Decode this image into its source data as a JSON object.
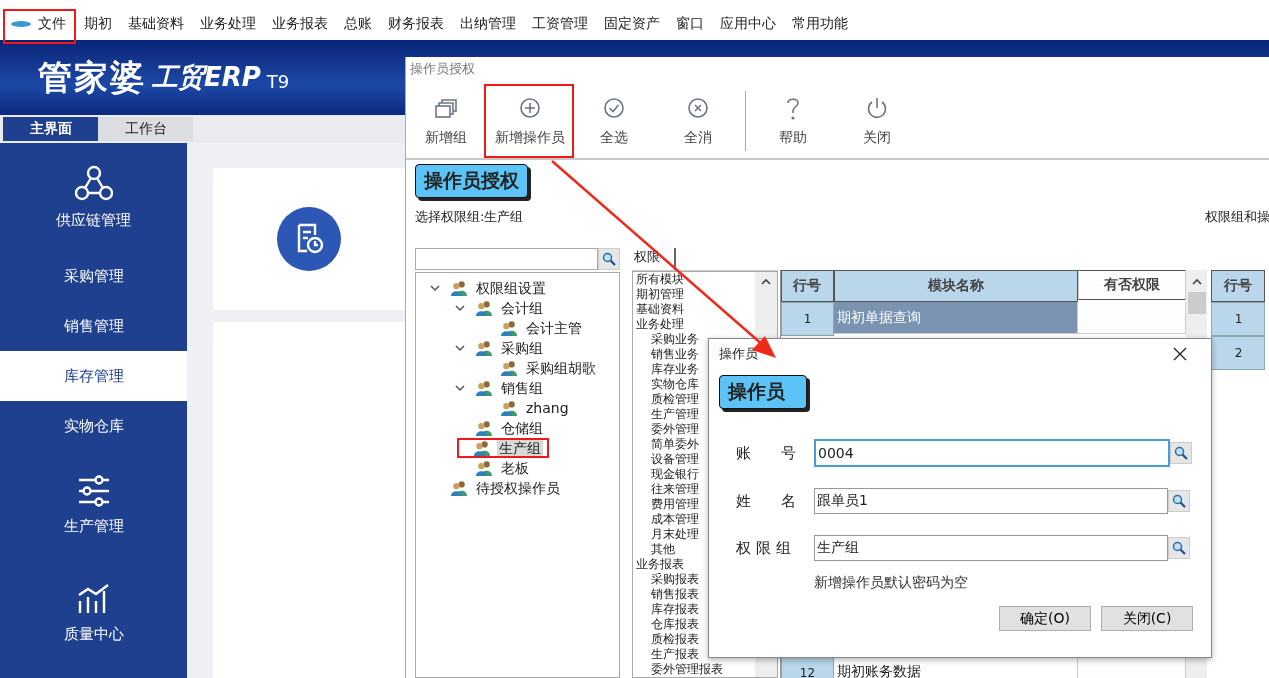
{
  "menu": [
    "文件",
    "期初",
    "基础资料",
    "业务处理",
    "业务报表",
    "总账",
    "财务报表",
    "出纳管理",
    "工资管理",
    "固定资产",
    "窗口",
    "应用中心",
    "常用功能"
  ],
  "logo": {
    "name": "管家婆",
    "product": "工贸ERP",
    "version": "T9"
  },
  "main_tabs": [
    {
      "label": "主界面",
      "selected": true
    },
    {
      "label": "工作台",
      "selected": false
    }
  ],
  "nav": [
    {
      "label": "供应链管理",
      "kind": "section",
      "selected": false
    },
    {
      "label": "采购管理",
      "kind": "item",
      "selected": false
    },
    {
      "label": "销售管理",
      "kind": "item",
      "selected": false
    },
    {
      "label": "库存管理",
      "kind": "item",
      "selected": true
    },
    {
      "label": "实物仓库",
      "kind": "item",
      "selected": false
    },
    {
      "label": "生产管理",
      "kind": "section",
      "selected": false
    },
    {
      "label": "质量中心",
      "kind": "section",
      "selected": false
    }
  ],
  "window": {
    "title": "操作员授权",
    "toolbar": [
      {
        "label": "新增组",
        "kind": "group"
      },
      {
        "label": "新增操作员",
        "kind": "add"
      },
      {
        "label": "全选",
        "kind": "check"
      },
      {
        "label": "全消",
        "kind": "cancel"
      },
      {
        "label": "帮助",
        "kind": "help"
      },
      {
        "label": "关闭",
        "kind": "power"
      }
    ],
    "heading": "操作员授权",
    "group_label": "选择权限组:生产组",
    "right_label": "权限组和操",
    "tree": [
      {
        "label": "权限组设置",
        "expanded": true,
        "selected": false,
        "children": [
          {
            "label": "会计组",
            "expanded": true,
            "selected": false,
            "children": [
              {
                "label": "会计主管",
                "selected": false
              }
            ]
          },
          {
            "label": "采购组",
            "expanded": true,
            "selected": false,
            "children": [
              {
                "label": "采购组胡歌",
                "selected": false
              }
            ]
          },
          {
            "label": "销售组",
            "expanded": true,
            "selected": false,
            "children": [
              {
                "label": "zhang",
                "selected": false
              }
            ]
          },
          {
            "label": "仓储组",
            "selected": false
          },
          {
            "label": "生产组",
            "selected": true
          },
          {
            "label": "老板",
            "selected": false
          }
        ]
      },
      {
        "label": "待授权操作员",
        "selected": false
      }
    ],
    "tab": "权限",
    "modules": [
      {
        "label": "所有模块"
      },
      {
        "label": "期初管理"
      },
      {
        "label": "基础资料"
      },
      {
        "label": "业务处理",
        "children": [
          {
            "label": "采购业务"
          },
          {
            "label": "销售业务"
          },
          {
            "label": "库存业务"
          },
          {
            "label": "实物仓库"
          },
          {
            "label": "质检管理"
          },
          {
            "label": "生产管理"
          },
          {
            "label": "委外管理"
          },
          {
            "label": "简单委外"
          },
          {
            "label": "设备管理"
          },
          {
            "label": "现金银行"
          },
          {
            "label": "往来管理"
          },
          {
            "label": "费用管理"
          },
          {
            "label": "成本管理"
          },
          {
            "label": "月末处理"
          },
          {
            "label": "其他"
          }
        ]
      },
      {
        "label": "业务报表",
        "children": [
          {
            "label": "采购报表"
          },
          {
            "label": "销售报表"
          },
          {
            "label": "库存报表"
          },
          {
            "label": "仓库报表"
          },
          {
            "label": "质检报表"
          },
          {
            "label": "生产报表"
          },
          {
            "label": "委外管理报表"
          }
        ]
      }
    ],
    "table": {
      "columns": [
        "行号",
        "模块名称",
        "有否权限"
      ],
      "rows": [
        {
          "row": "1",
          "module": "期初单据查询",
          "selected": true
        },
        {
          "row": "12",
          "module": "期初账务数据",
          "selected": false
        }
      ]
    },
    "table2": {
      "columns": [
        "行号"
      ],
      "rows": [
        "1",
        "2"
      ]
    }
  },
  "dialog": {
    "title": "操作员",
    "heading": "操作员",
    "fields": [
      {
        "label": "账　　号",
        "value": "0004",
        "focused": true
      },
      {
        "label": "姓　　名",
        "value": "跟单员1",
        "focused": false
      },
      {
        "label": "权 限 组",
        "value": "生产组",
        "focused": false
      }
    ],
    "note": "新增操作员默认密码为空",
    "buttons": [
      "确定(O)",
      "关闭(C)"
    ]
  }
}
